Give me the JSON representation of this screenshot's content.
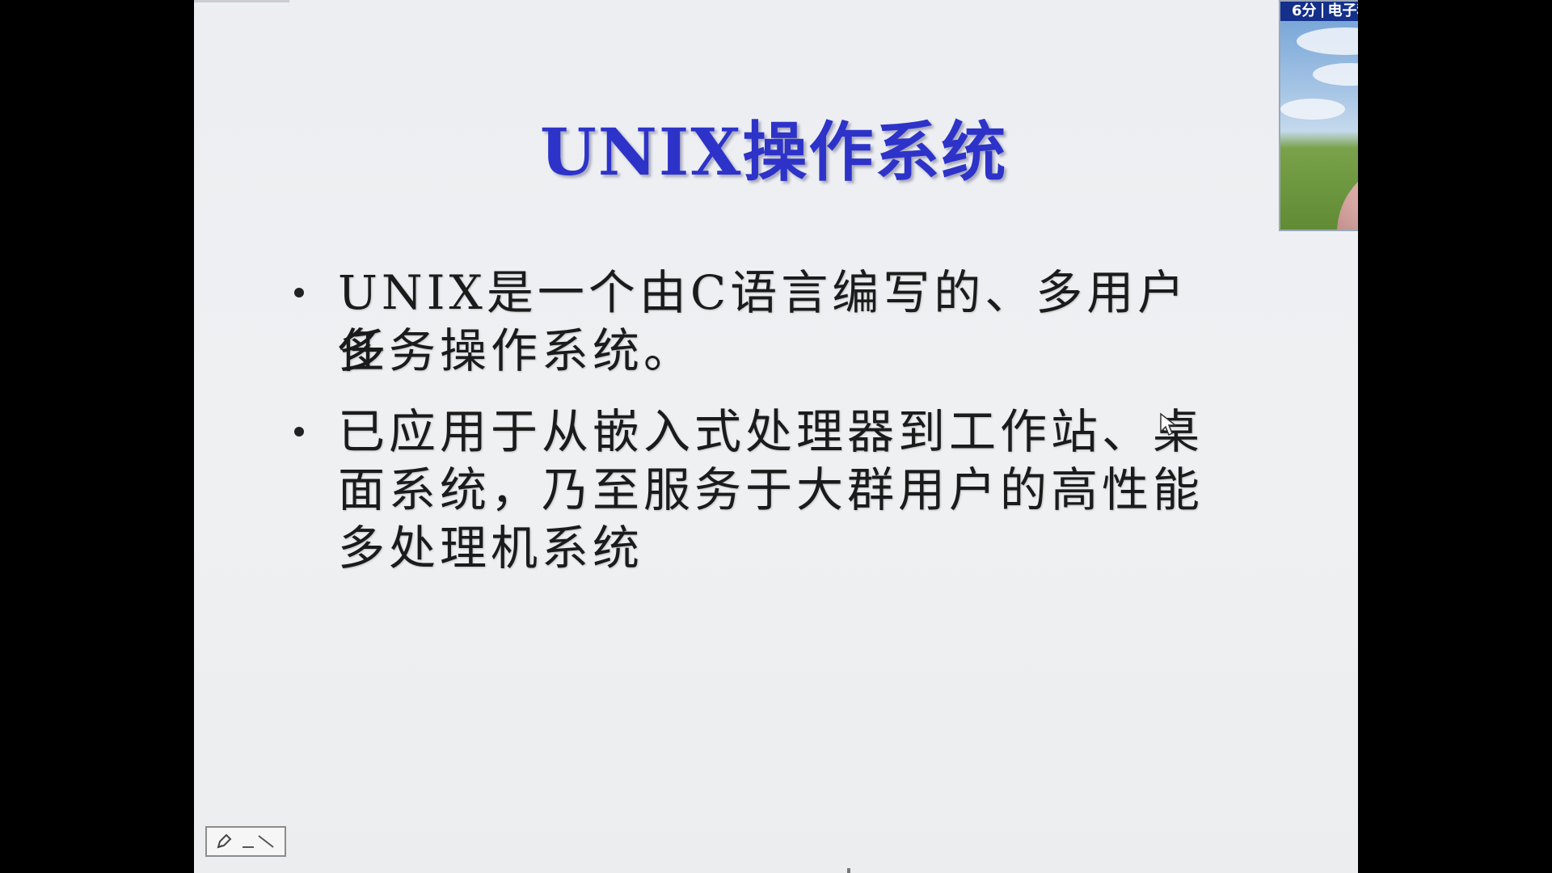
{
  "slide": {
    "title": "UNIX操作系统",
    "bullets": [
      {
        "lines": [
          "UNIX是一个由C语言编写的、多用户多",
          "任务操作系统。"
        ]
      },
      {
        "lines": [
          "已应用于从嵌入式处理器到工作站、桌",
          "面系统，乃至服务于大群用户的高性能",
          "多处理机系统"
        ]
      }
    ]
  },
  "webcam": {
    "time_label": "6分",
    "channel_label": "电子科技大学网络教育学院"
  },
  "icons": {
    "pen": "pen-tool-icon",
    "slash": "diagonal-line-icon",
    "cursor": "mouse-pointer-icon"
  },
  "colors": {
    "title": "#2d33c8",
    "slide_background": "#eceef1",
    "webcam_header": "#14308a"
  }
}
